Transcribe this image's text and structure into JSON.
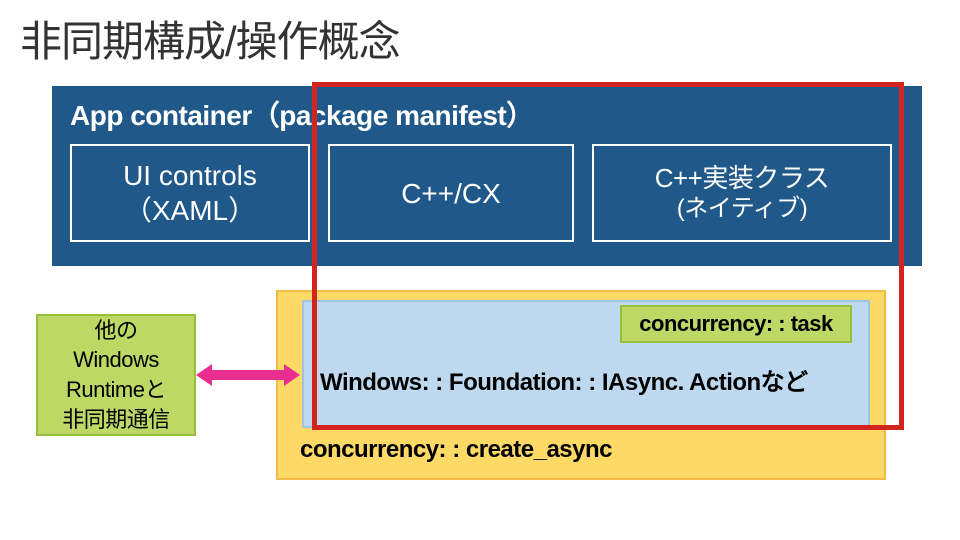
{
  "title": "非同期構成/操作概念",
  "app_container": {
    "label": "App container（package manifest）",
    "ui_controls_l1": "UI controls",
    "ui_controls_l2": "（XAML）",
    "cppcx": "C++/CX",
    "impl_l1": "C++実装クラス",
    "impl_l2": "(ネイティブ)"
  },
  "task_box": "concurrency: : task",
  "iasync": "Windows: : Foundation: : IAsync. Actionなど",
  "create_async": "concurrency: : create_async",
  "other_runtime": "他の\nWindows\nRuntimeと\n非同期通信"
}
